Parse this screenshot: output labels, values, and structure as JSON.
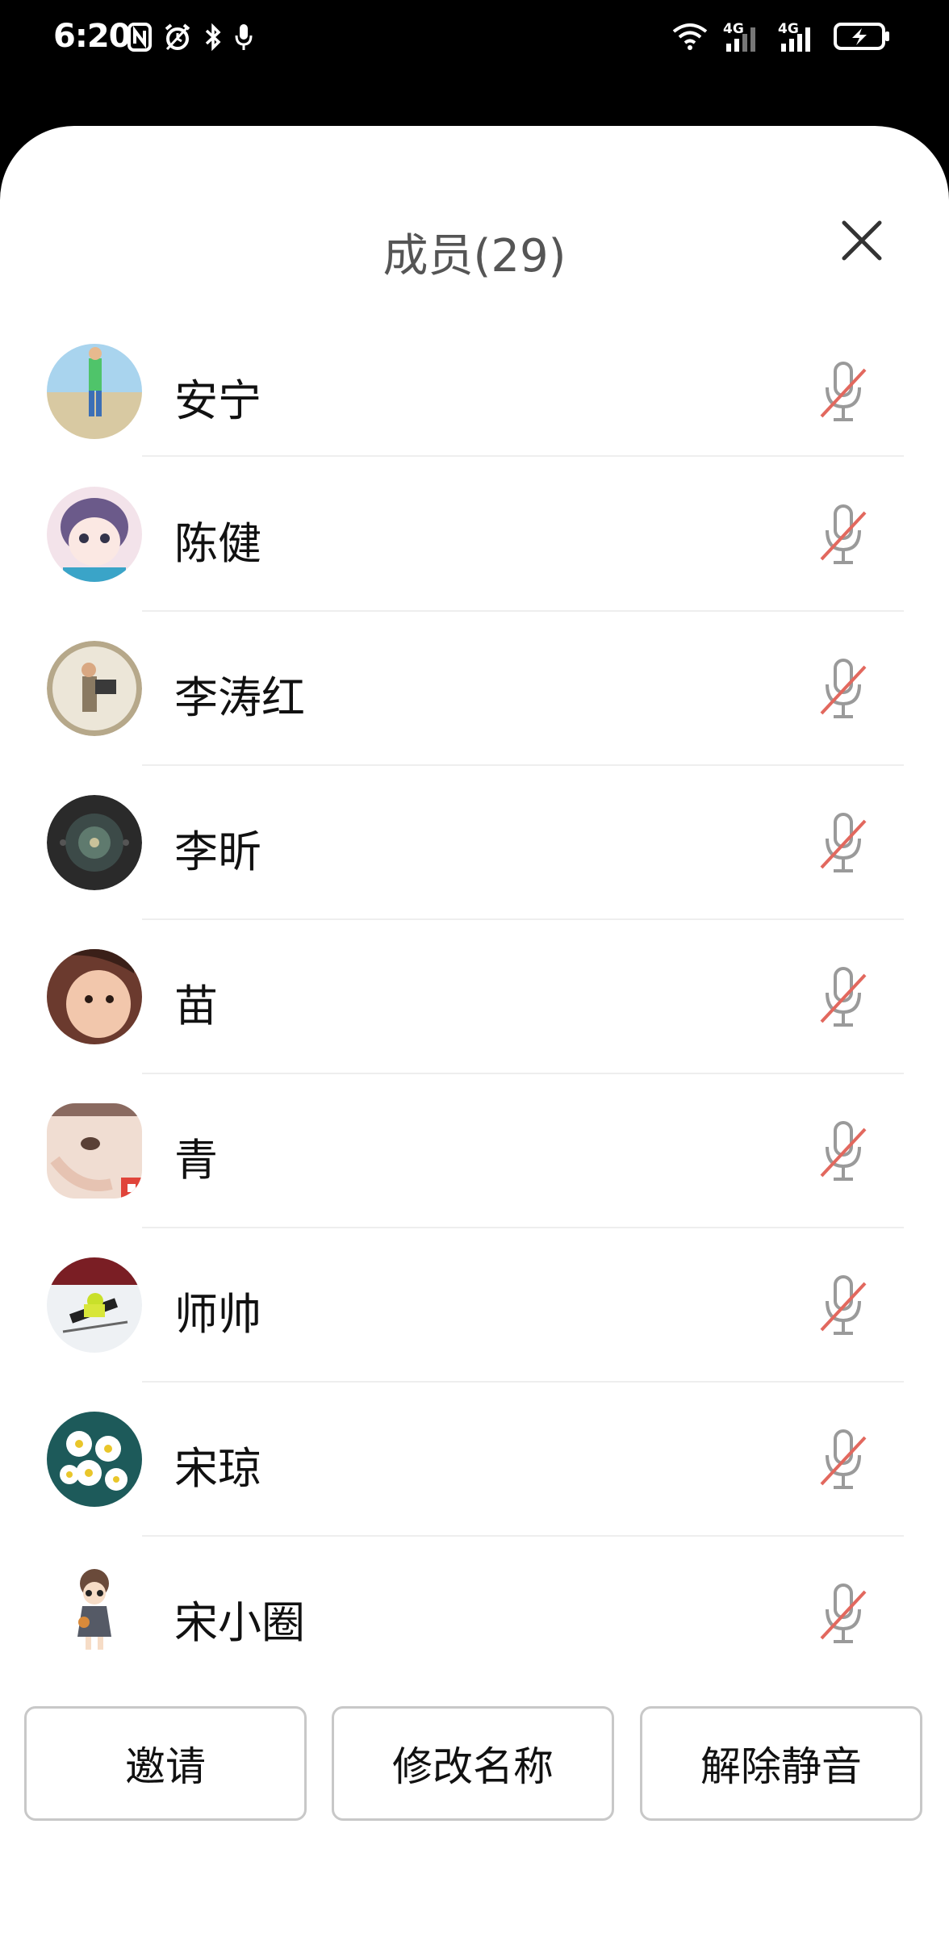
{
  "status_bar": {
    "time": "6:20",
    "left_icons": [
      "nfc-icon",
      "alarm-icon",
      "bluetooth-icon",
      "mic-icon"
    ],
    "right_icons": [
      "wifi-icon",
      "signal-4g-icon",
      "signal-4g-icon",
      "battery-charging-icon"
    ],
    "network_label_1": "4G",
    "network_label_2": "4G"
  },
  "sheet": {
    "title": "成员(29)",
    "close_icon": "close-icon"
  },
  "members": [
    {
      "name": "安宁",
      "mic_icon": "mic-muted-icon"
    },
    {
      "name": "陈健",
      "mic_icon": "mic-muted-icon"
    },
    {
      "name": "李涛红",
      "mic_icon": "mic-muted-icon"
    },
    {
      "name": "李昕",
      "mic_icon": "mic-muted-icon"
    },
    {
      "name": "苗",
      "mic_icon": "mic-muted-icon"
    },
    {
      "name": "青",
      "mic_icon": "mic-muted-icon"
    },
    {
      "name": "师帅",
      "mic_icon": "mic-muted-icon"
    },
    {
      "name": "宋琼",
      "mic_icon": "mic-muted-icon"
    },
    {
      "name": "宋小圈",
      "mic_icon": "mic-muted-icon"
    }
  ],
  "actions": {
    "invite": "邀请",
    "rename": "修改名称",
    "unmute": "解除静音"
  },
  "colors": {
    "muted_slash": "#e2685e",
    "mic_gray": "#9a9a9a",
    "title_gray": "#555555"
  }
}
